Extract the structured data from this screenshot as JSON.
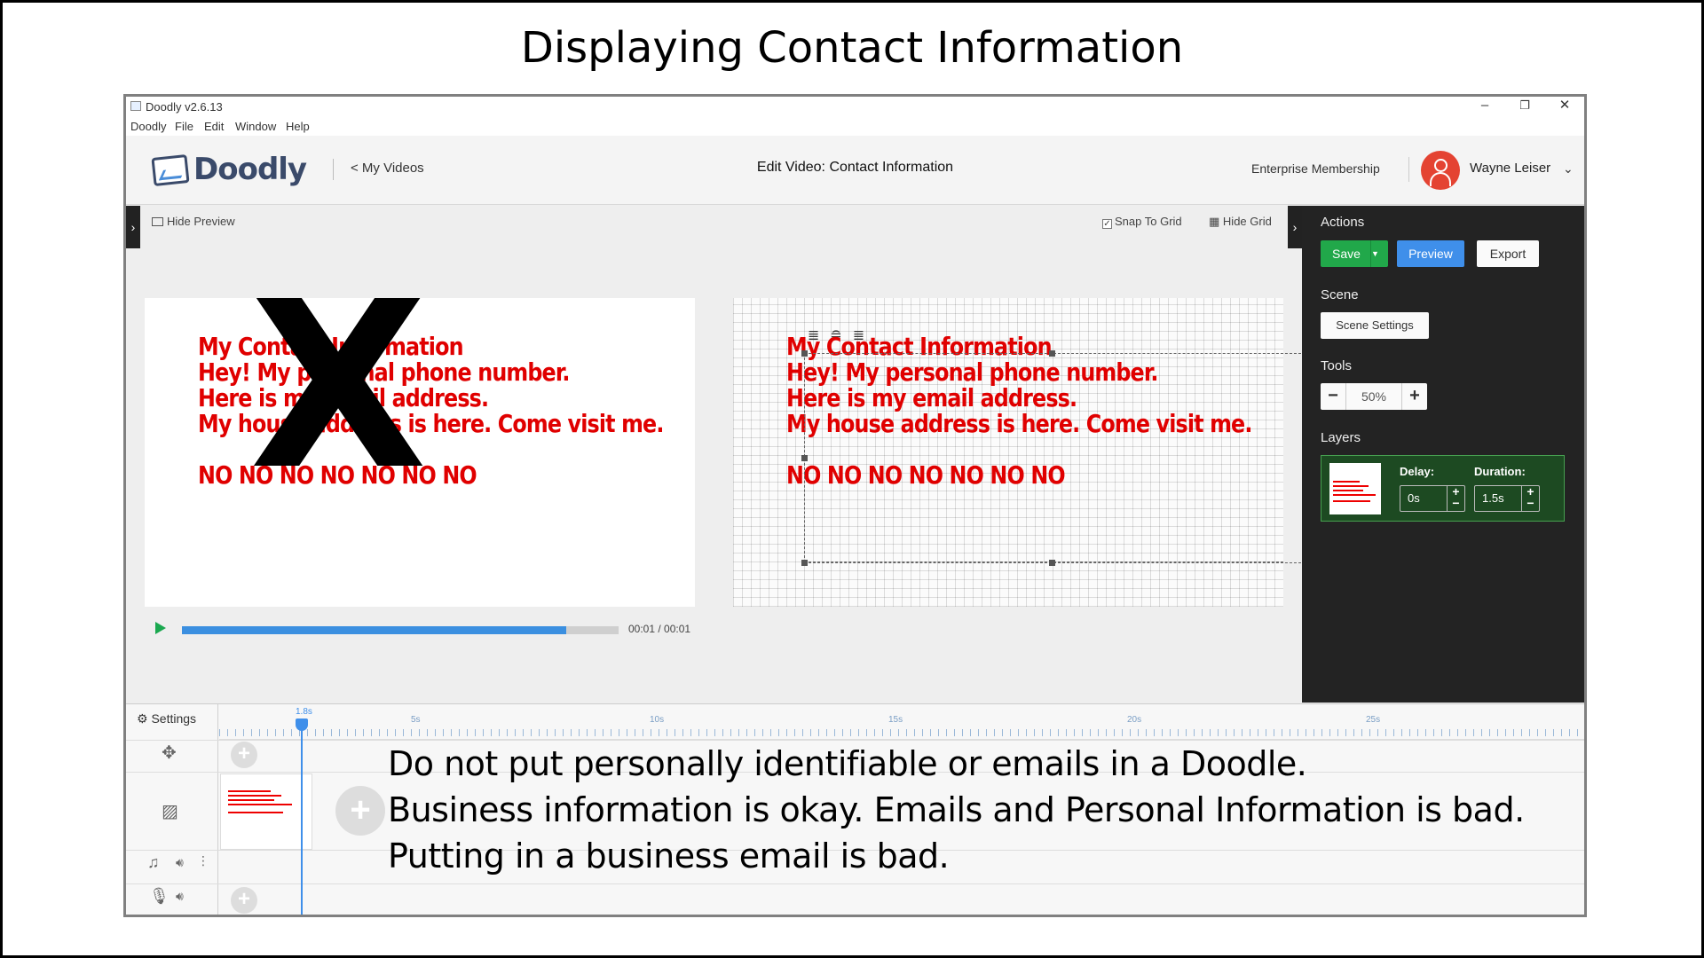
{
  "slide": {
    "title": "Displaying Contact Information",
    "notes": [
      "Do not put personally identifiable or emails in a Doodle.",
      "Business information is okay.  Emails and Personal Information is bad.",
      "Putting in a business email is bad."
    ],
    "overlay_mark": "X"
  },
  "window": {
    "title": "Doodly v2.6.13",
    "controls": {
      "minimize": "–",
      "maximize": "❐",
      "close": "✕"
    }
  },
  "menu": [
    "Doodly",
    "File",
    "Edit",
    "Window",
    "Help"
  ],
  "header": {
    "logo_text": "Doodly",
    "back_link": "< My Videos",
    "edit_title": "Edit Video: Contact Information",
    "membership": "Enterprise Membership",
    "user_name": "Wayne Leiser",
    "user_menu_icon": "chevron-down-icon"
  },
  "workspace": {
    "hide_preview": "Hide Preview",
    "snap_to_grid": "Snap To Grid",
    "snap_to_grid_checked": true,
    "hide_grid": "Hide Grid",
    "timecode": "00:01 / 00:01",
    "playback_progress": 0.88,
    "doodle_lines": [
      "My Contact Information",
      "Hey! My personal phone number.",
      "Here is my email address.",
      "My house address is here. Come visit me."
    ],
    "doodle_no_line": "NO NO NO NO NO NO NO"
  },
  "panel": {
    "actions_label": "Actions",
    "save": "Save",
    "preview": "Preview",
    "export": "Export",
    "scene_label": "Scene",
    "scene_settings": "Scene Settings",
    "tools_label": "Tools",
    "zoom_minus": "−",
    "zoom_value": "50%",
    "zoom_plus": "+",
    "layers_label": "Layers",
    "delay_label": "Delay:",
    "delay_value": "0s",
    "duration_label": "Duration:",
    "duration_value": "1.5s",
    "colors": {
      "save": "#21a84a",
      "preview": "#3f8fea",
      "panel_bg": "#232323",
      "layer_border": "#46a050"
    }
  },
  "timeline": {
    "settings_label": "Settings",
    "playhead_label": "1.8s",
    "ticks": [
      "5s",
      "10s",
      "15s",
      "20s",
      "25s"
    ]
  }
}
